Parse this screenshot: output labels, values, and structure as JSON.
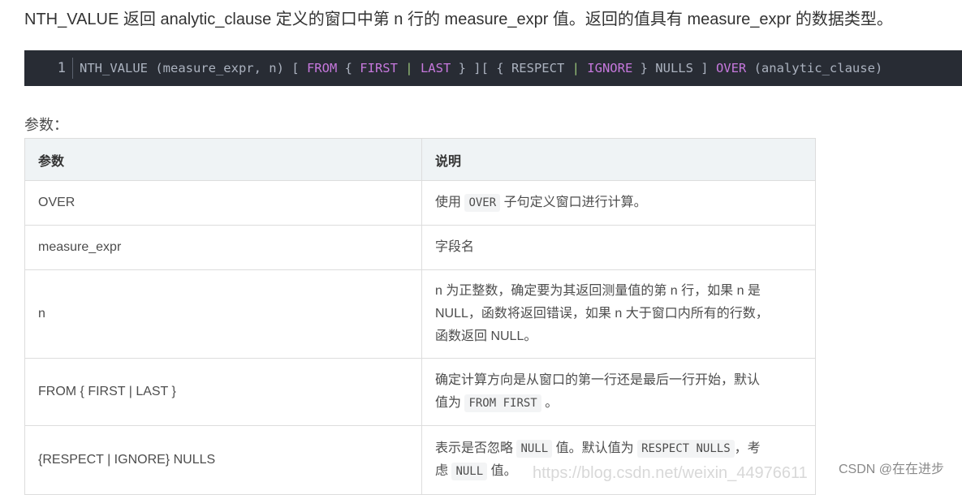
{
  "intro": "NTH_VALUE 返回 analytic_clause 定义的窗口中第 n 行的 measure_expr 值。返回的值具有 measure_expr 的数据类型。",
  "code": {
    "line_number": "1",
    "t1": "NTH_VALUE (measure_expr, n) [ ",
    "k1": "FROM",
    "t2": " { ",
    "k2": "FIRST",
    "p1": " | ",
    "k3": "LAST",
    "t3": " } ][ { RESPECT ",
    "p2": "| ",
    "k4": "IGNORE",
    "t4": " } NULLS ] ",
    "k5": "OVER",
    "t5": " (analytic_clause)"
  },
  "params_label": "参数：",
  "table": {
    "headers": [
      "参数",
      "说明"
    ],
    "rows": [
      {
        "param": "OVER",
        "d1": "使用 ",
        "c1": "OVER",
        "d2": " 子句定义窗口进行计算。"
      },
      {
        "param": "measure_expr",
        "d1": "字段名"
      },
      {
        "param": "n",
        "l1": "n 为正整数，确定要为其返回测量值的第 n 行，如果 n 是",
        "l2": "NULL，函数将返回错误，如果 n 大于窗口内所有的行数，",
        "l3": "函数返回 NULL。"
      },
      {
        "param": "FROM { FIRST | LAST }",
        "l1": "确定计算方向是从窗口的第一行还是最后一行开始，默认",
        "l2a": "值为 ",
        "c1": "FROM FIRST",
        "l2b": " 。"
      },
      {
        "param": "{RESPECT | IGNORE} NULLS",
        "l1a": "表示是否忽略 ",
        "c1": "NULL",
        "l1b": " 值。默认值为 ",
        "c2": "RESPECT NULLS",
        "l1c": "，考",
        "l2a": "虑 ",
        "c3": "NULL",
        "l2b": " 值。"
      }
    ]
  },
  "watermark_url": "https://blog.csdn.net/weixin_44976611",
  "watermark_csdn": "CSDN @在在进步"
}
